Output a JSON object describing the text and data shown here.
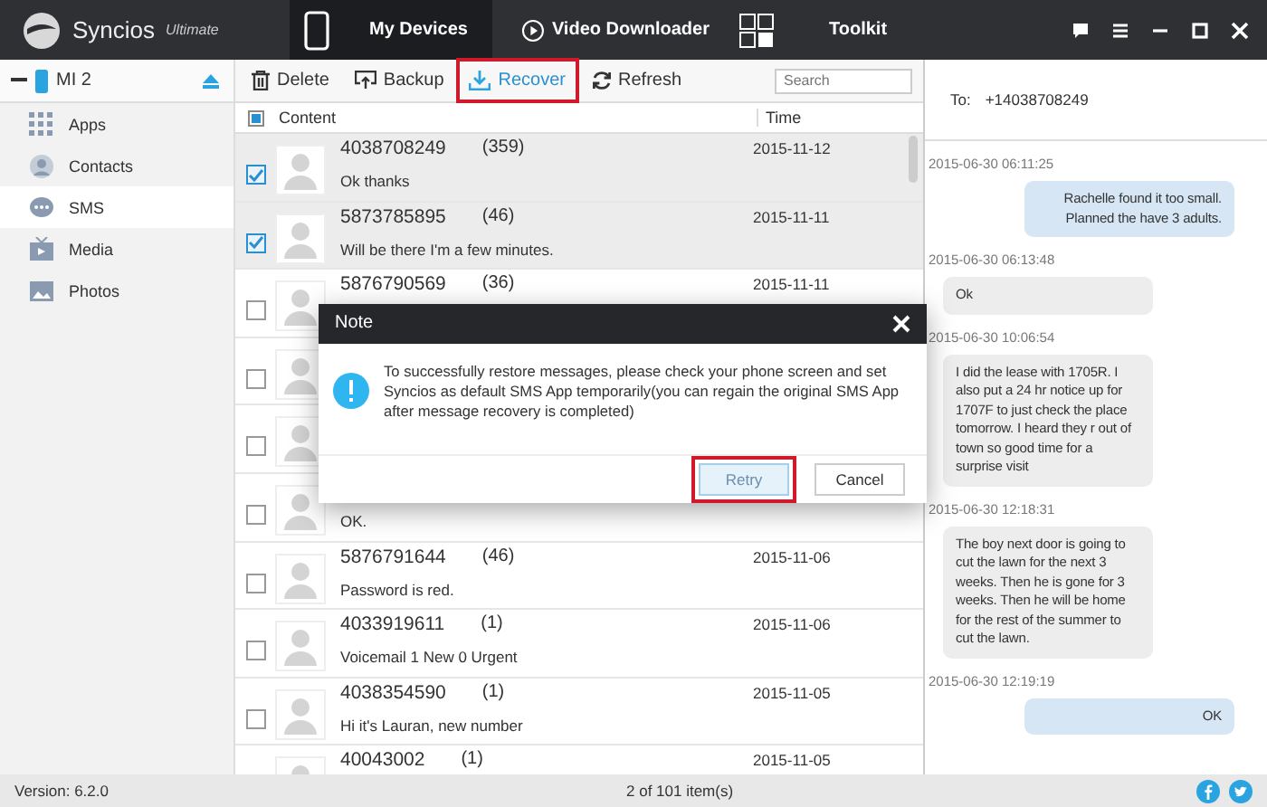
{
  "app": {
    "name": "Syncios",
    "edition": "Ultimate"
  },
  "tabs": [
    {
      "label": "My Devices",
      "selected": true
    },
    {
      "label": "Video Downloader",
      "selected": false
    },
    {
      "label": "Toolkit",
      "selected": false
    }
  ],
  "device": {
    "name": "MI 2"
  },
  "sidebar": {
    "items": [
      {
        "label": "Apps",
        "selected": false
      },
      {
        "label": "Contacts",
        "selected": false
      },
      {
        "label": "SMS",
        "selected": true
      },
      {
        "label": "Media",
        "selected": false
      },
      {
        "label": "Photos",
        "selected": false
      }
    ]
  },
  "toolbar": [
    {
      "label": "Delete",
      "highlighted": false
    },
    {
      "label": "Backup",
      "highlighted": false
    },
    {
      "label": "Recover",
      "highlighted": true
    },
    {
      "label": "Refresh",
      "highlighted": false
    }
  ],
  "search": {
    "placeholder": "Search"
  },
  "table": {
    "select_all": {
      "indeterminate": true
    },
    "columns": [
      "Content",
      "Time"
    ],
    "rows": [
      {
        "checked": true,
        "number": "4038708249",
        "count": "(359)",
        "message": "Ok thanks",
        "time": "2015-11-12"
      },
      {
        "checked": true,
        "number": "5873785895",
        "count": "(46)",
        "message": "Will be there I'm a few minutes.",
        "time": "2015-11-11"
      },
      {
        "checked": false,
        "number": "5876790569",
        "count": "(36)",
        "time": "2015-11-11"
      },
      {
        "checked": false
      },
      {
        "checked": false
      },
      {
        "checked": false,
        "message": "OK."
      },
      {
        "checked": false,
        "number": "5876791644",
        "count": "(46)",
        "message": "Password is red.",
        "time": "2015-11-06"
      },
      {
        "checked": false,
        "number": "4033919611",
        "count": "(1)",
        "message": "Voicemail   1 New      0 Urgent",
        "time": "2015-11-06"
      },
      {
        "checked": false,
        "number": "4038354590",
        "count": "(1)",
        "message": "Hi it's Lauran, new number",
        "time": "2015-11-05"
      },
      {
        "number": "40043002",
        "count": "(1)",
        "time": "2015-11-05"
      }
    ]
  },
  "conversation": {
    "to_label": "To:",
    "to": "+14038708249",
    "messages": [
      {
        "time": "2015-06-30 06:11:25",
        "kind": "sent",
        "text": "Rachelle found it too small. Planned the have 3 adults."
      },
      {
        "time": "2015-06-30 06:13:48",
        "kind": "received",
        "text": "Ok"
      },
      {
        "time": "2015-06-30 10:06:54",
        "kind": "received",
        "text": "I did the lease with 1705R. I also put a 24 hr notice up for 1707F to just check the place tomorrow. I heard they r out of town so good time for a surprise visit"
      },
      {
        "time": "2015-06-30 12:18:31",
        "kind": "received",
        "text": "The boy next door is going to cut the lawn for the next 3 weeks. Then he is gone for 3 weeks. Then he will be home for the rest of the summer to cut the lawn."
      },
      {
        "time": "2015-06-30 12:19:19",
        "kind": "sent",
        "text": "OK"
      }
    ]
  },
  "dialog": {
    "title": "Note",
    "message": "To successfully restore messages, please check your phone screen and set Syncios as default SMS App temporarily(you can regain the original SMS App after message recovery is completed)",
    "buttons": [
      {
        "label": "Retry",
        "highlighted": true
      },
      {
        "label": "Cancel",
        "highlighted": false
      }
    ]
  },
  "status_bar": {
    "version": "Version: 6.2.0",
    "count": "2 of 101 item(s)"
  }
}
